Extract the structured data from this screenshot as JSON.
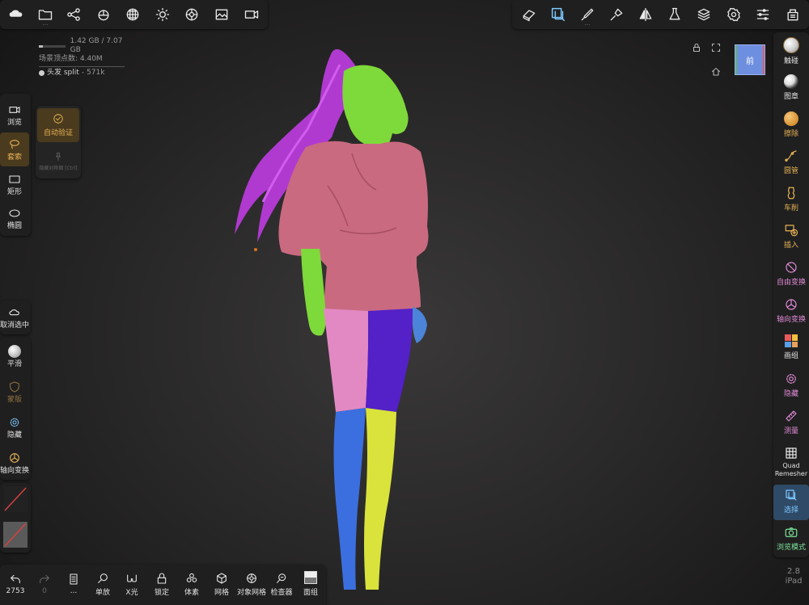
{
  "top_left_toolbar": {
    "icons": [
      "cloud-icon",
      "folder-icon",
      "share-nodes-icon",
      "stats-icon",
      "grid-sphere-icon",
      "sun-icon",
      "aperture-icon",
      "image-icon",
      "video-icon"
    ]
  },
  "top_right_toolbar": {
    "icons": [
      "eraser-3d-icon",
      "select-tool-icon",
      "brush-icon",
      "paint-brush-icon",
      "symmetry-icon",
      "flask-icon",
      "layers-icon",
      "gear-icon",
      "sliders-icon",
      "scene-icon"
    ]
  },
  "stats": {
    "memory": "1.42 GB / 7.07 GB",
    "vertices": "场景顶点数: 4.40M",
    "object_name": "头发 split",
    "object_count": "571k"
  },
  "viewcube": {
    "label": "前"
  },
  "left_tools": [
    {
      "label": "浏览",
      "icon": "camera-icon"
    },
    {
      "label": "套索",
      "icon": "lasso-icon"
    },
    {
      "label": "矩形",
      "icon": "rectangle-icon"
    },
    {
      "label": "椭圆",
      "icon": "ellipse-icon"
    }
  ],
  "left_popup": {
    "auto_verify": "自动验证",
    "disabled_text": "隐藏对称面 [Ctrl]"
  },
  "left_lower_tools": [
    {
      "label": "取消选中",
      "icon": "cloud-outline-icon"
    },
    {
      "label": "平滑",
      "icon": "smooth-ball-icon"
    },
    {
      "label": "蒙版",
      "icon": "mask-shield-icon"
    },
    {
      "label": "隐藏",
      "icon": "hide-icon"
    },
    {
      "label": "轴向变换",
      "icon": "gizmo-icon"
    }
  ],
  "right_tools": [
    {
      "label": "触碰",
      "icon": "touch-icon",
      "color": "#e8e8e8"
    },
    {
      "label": "图章",
      "icon": "stamp-icon",
      "color": "#e8e8e8"
    },
    {
      "label": "擦除",
      "icon": "eraser-icon",
      "color": "#e6b256"
    },
    {
      "label": "圆管",
      "icon": "tube-icon",
      "color": "#e6b256"
    },
    {
      "label": "车削",
      "icon": "lathe-icon",
      "color": "#e6b256"
    },
    {
      "label": "插入",
      "icon": "insert-icon",
      "color": "#e6b256"
    },
    {
      "label": "自由变换",
      "icon": "free-transform-icon",
      "color": "#e08ad6"
    },
    {
      "label": "轴向变换",
      "icon": "axis-transform-icon",
      "color": "#e08ad6"
    },
    {
      "label": "画组",
      "icon": "paint-group-icon",
      "color": "#e8e8e8"
    },
    {
      "label": "隐藏",
      "icon": "hide-icon",
      "color": "#e08ad6"
    },
    {
      "label": "测量",
      "icon": "ruler-icon",
      "color": "#e08ad6"
    },
    {
      "label": "Quad Remesher",
      "icon": "grid-icon",
      "color": "#e8e8e8"
    },
    {
      "label": "选择",
      "icon": "select-icon",
      "color": "#7ec8ff"
    },
    {
      "label": "浏览模式",
      "icon": "camera-icon",
      "color": "#7ee39a"
    }
  ],
  "bottom_toolbar": [
    {
      "label": "2753",
      "icon": "undo-icon"
    },
    {
      "label": "0",
      "icon": "redo-icon"
    },
    {
      "label": "...",
      "icon": "list-icon"
    },
    {
      "label": "单放",
      "icon": "search-icon"
    },
    {
      "label": "X光",
      "icon": "xray-glasses-icon"
    },
    {
      "label": "锁定",
      "icon": "lock-icon"
    },
    {
      "label": "体素",
      "icon": "voxel-icon"
    },
    {
      "label": "网格",
      "icon": "mesh-grid-icon"
    },
    {
      "label": "对象网格",
      "icon": "object-mesh-icon"
    },
    {
      "label": "检查器",
      "icon": "inspector-icon"
    },
    {
      "label": "面组",
      "icon": "face-group-icon"
    }
  ],
  "version": {
    "number": "2.8",
    "device": "iPad"
  },
  "colors": {
    "accent_gold": "#e6b256",
    "accent_pink": "#e08ad6",
    "accent_blue": "#7ec8ff",
    "accent_green": "#7ee39a"
  }
}
